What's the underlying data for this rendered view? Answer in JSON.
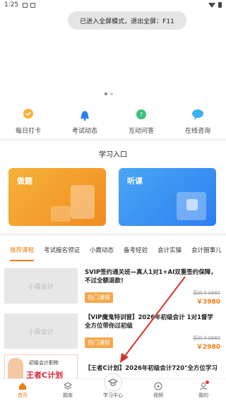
{
  "status_bar": {
    "time": "1:25"
  },
  "toast": "已进入全屏模式，退出全屏：F11",
  "quick_nav": [
    {
      "label": "每日打卡",
      "icon": "checkin-icon",
      "color": "#f5b23a"
    },
    {
      "label": "考试动态",
      "icon": "bell-icon",
      "color": "#2d7ff0"
    },
    {
      "label": "互动问答",
      "icon": "qa-icon",
      "color": "#3cc17a"
    },
    {
      "label": "在线咨询",
      "icon": "chat-icon",
      "color": "#39b3f0"
    }
  ],
  "learn_section": {
    "title": "学习入口",
    "cards": [
      {
        "label": "做题"
      },
      {
        "label": "听课"
      }
    ]
  },
  "tabs": [
    "推荐课程",
    "考试报名领证",
    "小霞动态",
    "备考经验",
    "会计实操",
    "会计圈事儿"
  ],
  "courses": [
    {
      "thumb": "小霞会计",
      "title": "SVIP签约通关班—真人1对1+AI双重签约保障，不过全额退款!",
      "badge": "热门课程",
      "old_price": "原价￥3980",
      "price": "￥3980"
    },
    {
      "thumb": "小霞会计",
      "title": "【VIP魔鬼特训营】2026年初级会计 1对1督学 全方位带你过初级",
      "badge": "热门课程",
      "old_price": "原价￥3980",
      "price": "￥2980"
    },
    {
      "thumb_text": "初级会计职称",
      "thumb_big": "王者C计划",
      "title": "【王者C计划】2026年初级会计720°全方位学习"
    }
  ],
  "bottom_nav": [
    {
      "label": "首页",
      "icon": "home-icon",
      "active": true
    },
    {
      "label": "题库",
      "icon": "question-bank-icon"
    },
    {
      "label": "学习中心",
      "icon": "graduation-cap-icon"
    },
    {
      "label": "视频",
      "icon": "video-icon"
    },
    {
      "label": "我的",
      "icon": "profile-icon"
    }
  ],
  "colors": {
    "accent": "#f07d10",
    "annotation": "#d9302c"
  }
}
